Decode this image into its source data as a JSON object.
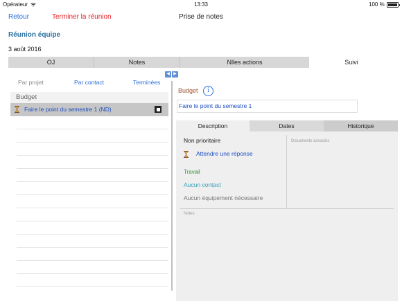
{
  "status_bar": {
    "carrier": "Opérateur",
    "time": "13:33",
    "battery": "100 %"
  },
  "nav": {
    "back": "Retour",
    "end_meeting": "Terminer la réunion",
    "title": "Prise de notes"
  },
  "meeting": {
    "title": "Réunion équipe",
    "date": "3 août 2016"
  },
  "tabs": [
    "OJ",
    "Notes",
    "Nlles actions",
    "Suivi"
  ],
  "filters": {
    "by_project": "Par projet",
    "by_contact": "Par contact",
    "done": "Terminées"
  },
  "list": {
    "group": "Budget",
    "items": [
      {
        "label": "Faire le point du semestre 1 (ND)"
      }
    ]
  },
  "detail": {
    "project": "Budget",
    "title": "Faire le point du semestre 1",
    "tabs": [
      "Description",
      "Dates",
      "Historique"
    ],
    "priority": "Non prioritaire",
    "status": "Attendre une réponse",
    "category": "Travail",
    "contact": "Aucun contact",
    "equipment": "Aucun équipement nécessaire",
    "documents_label": "Documents associés",
    "notes_label": "Notes"
  },
  "colors": {
    "accent": "#2a6fd6",
    "destructive": "#e0262d",
    "link": "#1d4fc2",
    "project": "#a0522d",
    "category": "#3a8f3a"
  },
  "icons": [
    "wifi-icon",
    "battery-icon",
    "arrow-left-icon",
    "arrow-right-icon",
    "hourglass-icon",
    "checkbox-icon",
    "info-icon"
  ]
}
